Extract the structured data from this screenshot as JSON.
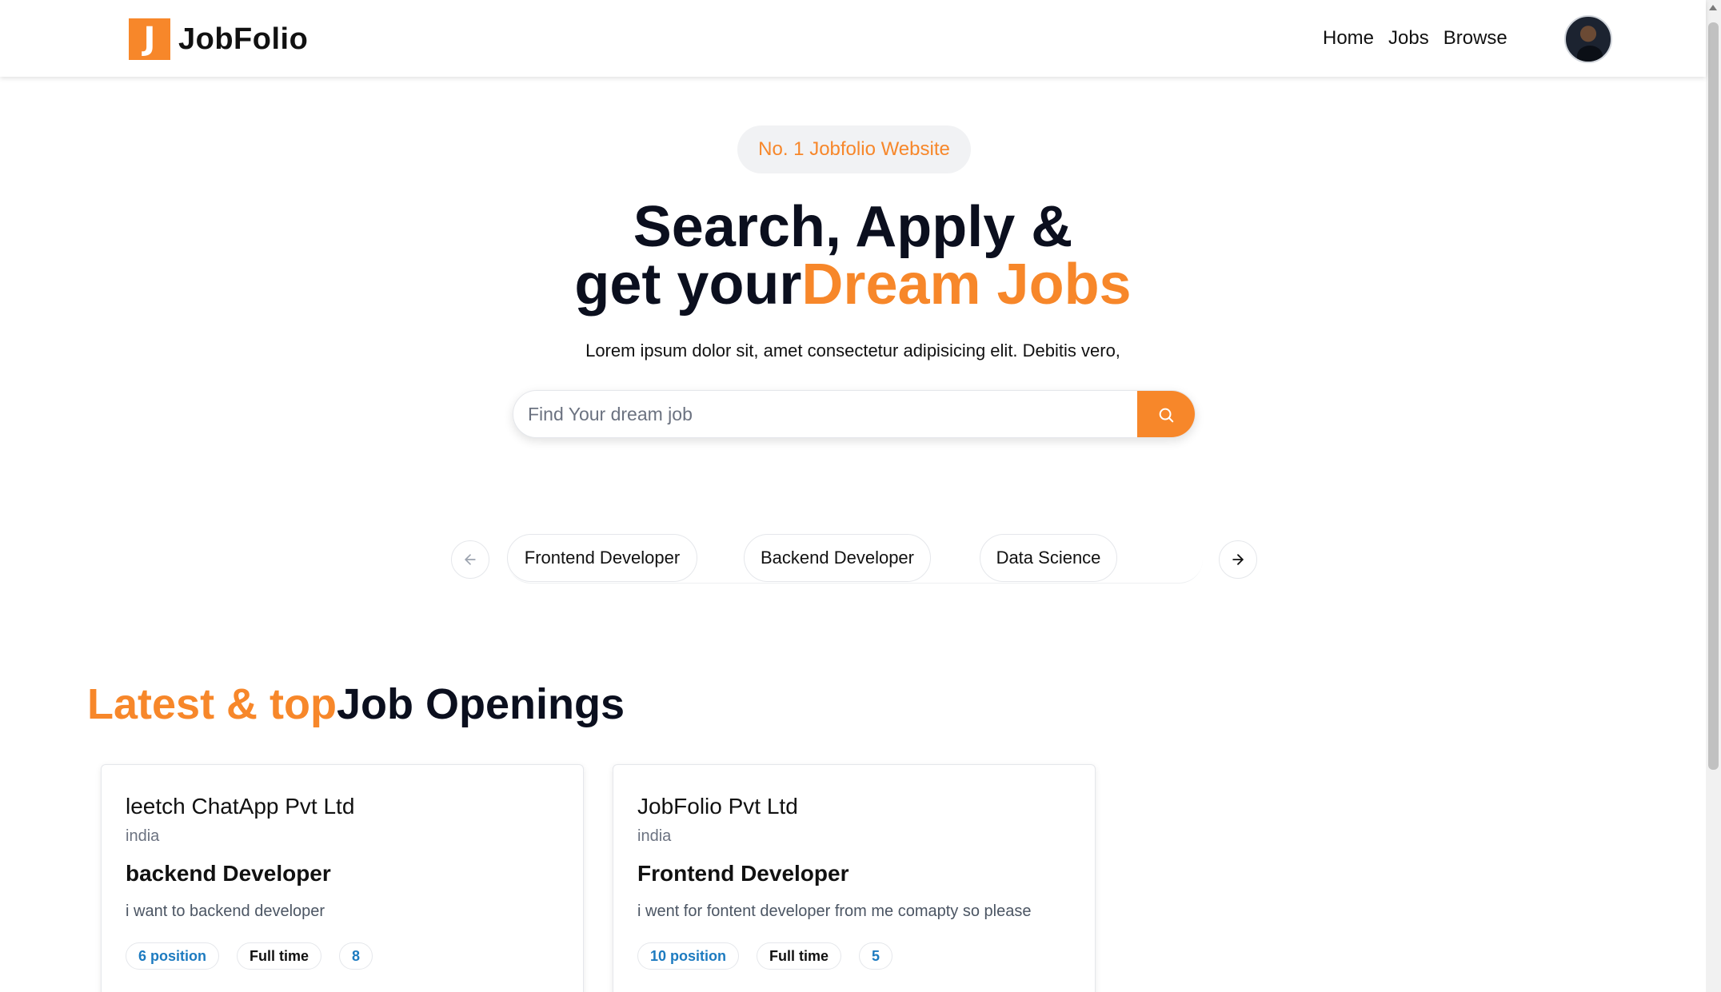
{
  "navbar": {
    "logo_letter": "J",
    "logo_text": "JobFolio",
    "links": [
      "Home",
      "Jobs",
      "Browse"
    ]
  },
  "hero": {
    "badge": "No. 1 Jobfolio Website",
    "title_line1": "Search, Apply &",
    "title_line2_prefix": "get your",
    "title_line2_accent": "Dream Jobs",
    "subtitle": "Lorem ipsum dolor sit, amet consectetur adipisicing elit. Debitis vero,",
    "search_placeholder": "Find Your dream job"
  },
  "categories": [
    "Frontend Developer",
    "Backend Developer",
    "Data Science"
  ],
  "latest": {
    "title_accent": "Latest & top",
    "title_rest": "Job Openings"
  },
  "jobs": [
    {
      "company": "leetch ChatApp Pvt Ltd",
      "location": "india",
      "title": "backend Developer",
      "description": "i want to backend developer",
      "positions": "6 position",
      "job_type": "Full time",
      "salary": "8"
    },
    {
      "company": "JobFolio Pvt Ltd",
      "location": "india",
      "title": "Frontend Developer",
      "description": "i went for fontent developer from me comapty so please",
      "positions": "10 position",
      "job_type": "Full time",
      "salary": "5"
    }
  ],
  "colors": {
    "accent": "#f7872a",
    "tag_blue": "#1d7bc0",
    "dark": "#0b0f1e"
  },
  "icons": {
    "search": "search-icon",
    "prev": "arrow-left-icon",
    "next": "arrow-right-icon"
  }
}
